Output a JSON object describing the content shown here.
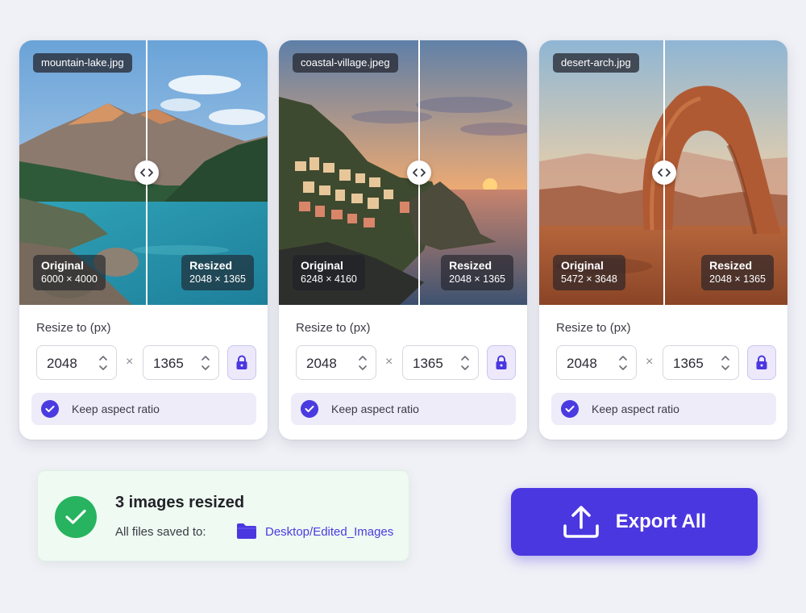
{
  "images": [
    {
      "filename": "mountain-lake.jpg",
      "original_label": "Original",
      "original_dims": "6000 × 4000",
      "resized_label": "Resized",
      "resized_dims": "2048 × 1365",
      "resize_label": "Resize to (px)",
      "width_value": "2048",
      "height_value": "1365",
      "times_symbol": "×",
      "aspect_label": "Keep aspect ratio",
      "aspect_checked": true,
      "aspect_locked": true
    },
    {
      "filename": "coastal-village.jpeg",
      "original_label": "Original",
      "original_dims": "6248 × 4160",
      "resized_label": "Resized",
      "resized_dims": "2048 × 1365",
      "resize_label": "Resize to (px)",
      "width_value": "2048",
      "height_value": "1365",
      "times_symbol": "×",
      "aspect_label": "Keep aspect ratio",
      "aspect_checked": true,
      "aspect_locked": true
    },
    {
      "filename": "desert-arch.jpg",
      "original_label": "Original",
      "original_dims": "5472 × 3648",
      "resized_label": "Resized",
      "resized_dims": "2048 × 1365",
      "resize_label": "Resize to (px)",
      "width_value": "2048",
      "height_value": "1365",
      "times_symbol": "×",
      "aspect_label": "Keep aspect ratio",
      "aspect_checked": true,
      "aspect_locked": true
    }
  ],
  "status": {
    "title": "3 images resized",
    "saved_label": "All files saved to:",
    "path": "Desktop/Edited_Images"
  },
  "export": {
    "label": "Export All"
  },
  "icons": {
    "compare_handle": "chevron-left-right-icon",
    "lock": "lock-icon",
    "checkbox": "check-circle-icon",
    "success": "check-circle-icon",
    "folder": "folder-icon",
    "export": "upload-icon"
  },
  "colors": {
    "accent": "#4b37e0",
    "success": "#27b35f",
    "aspect_row_bg": "#eeecf9",
    "status_bg": "#eefaf2",
    "page_bg": "#f0f1f6"
  }
}
